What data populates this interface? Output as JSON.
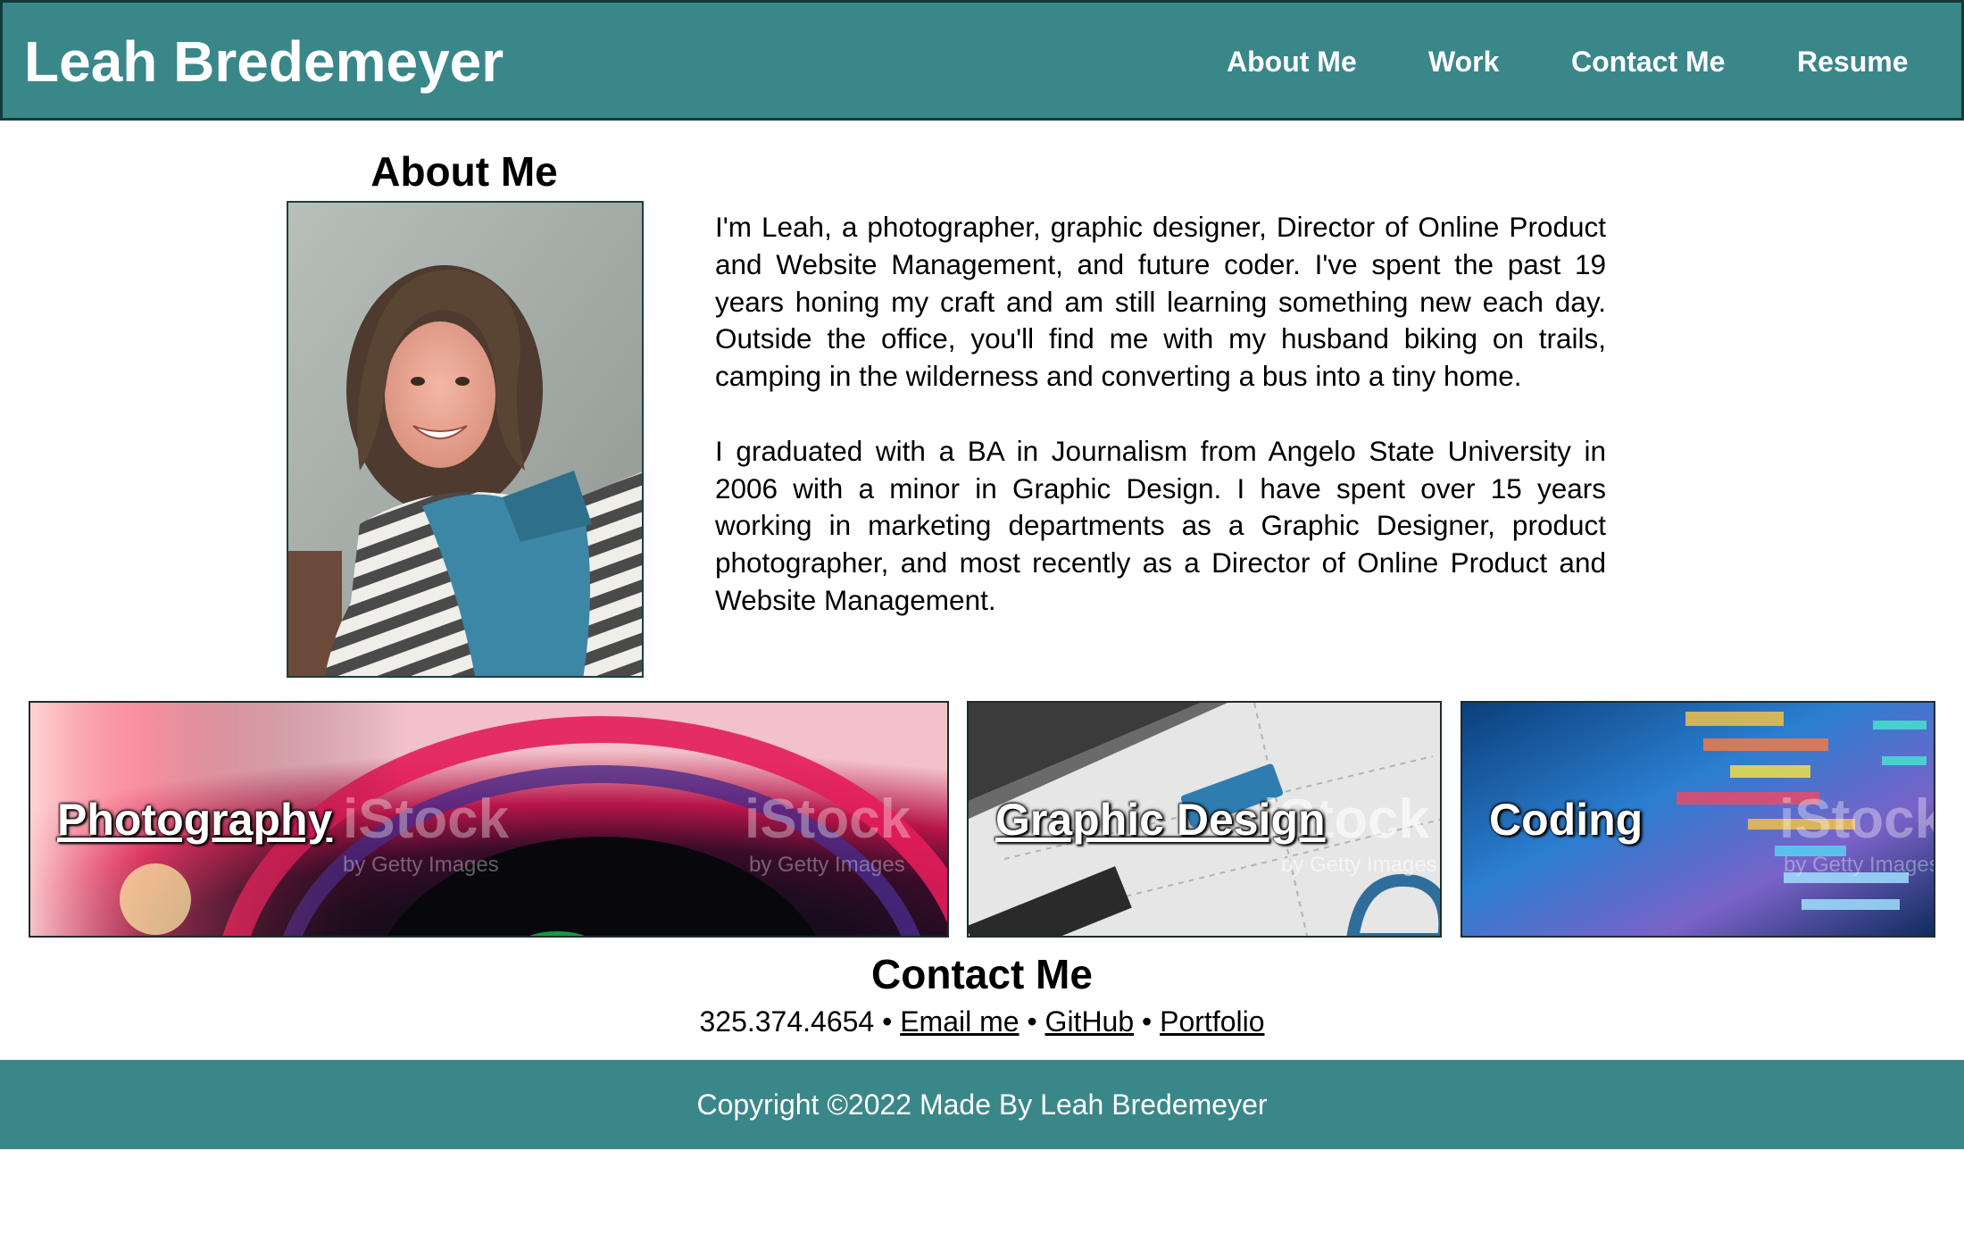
{
  "header": {
    "title": "Leah Bredemeyer",
    "nav": [
      {
        "label": "About Me"
      },
      {
        "label": "Work"
      },
      {
        "label": "Contact Me"
      },
      {
        "label": "Resume"
      }
    ]
  },
  "about": {
    "heading": "About Me",
    "paragraphs": [
      "I'm Leah, a photographer, graphic designer, Director of Online Product and Website Management, and future coder. I've spent the past 19 years honing my craft and am still learning something new each day. Outside the office, you'll find me with my husband biking on trails, camping in the wilderness and converting a bus into a tiny home.",
      "I graduated with a BA in Journalism from Angelo State University in 2006 with a minor in Graphic Design. I have spent over 15 years working in marketing departments as a Graphic Designer, product photographer, and most recently as a Director of Online Product and Website Management."
    ]
  },
  "work": {
    "tiles": [
      {
        "label": "Photography"
      },
      {
        "label": "Graphic Design"
      },
      {
        "label": "Coding"
      }
    ],
    "watermark": {
      "brand": "iStock",
      "sub": "by Getty Images"
    }
  },
  "contact": {
    "heading": "Contact Me",
    "phone": "325.374.4654",
    "separator": "•",
    "links": {
      "email": "Email me",
      "github": "GitHub",
      "portfolio": "Portfolio"
    }
  },
  "footer": {
    "copyright": "Copyright ©2022 Made By Leah Bredemeyer"
  },
  "colors": {
    "header_bg": "#3a878a",
    "header_border": "#14383a",
    "footer_bg": "#3a878a"
  }
}
